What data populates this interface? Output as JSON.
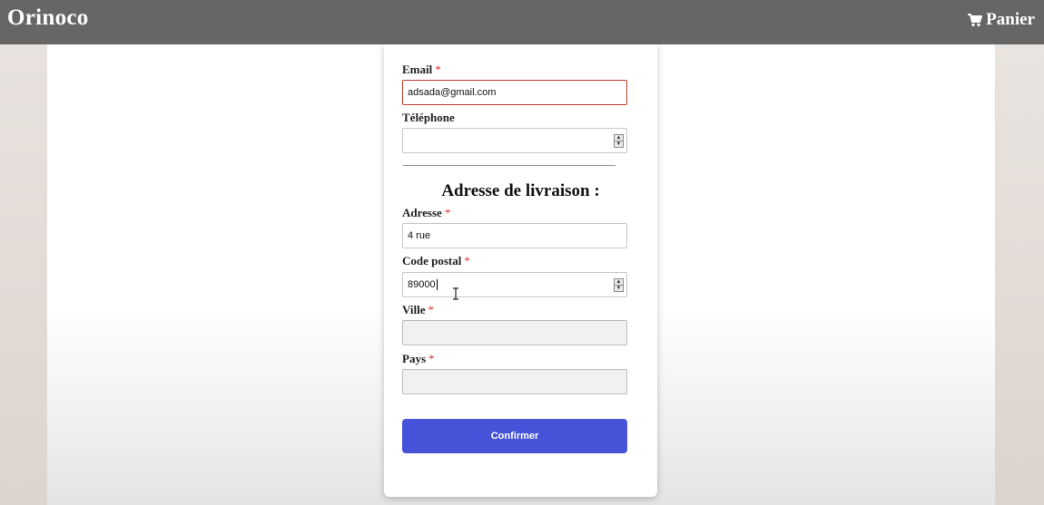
{
  "header": {
    "brand": "Orinoco",
    "cart_label": "Panier",
    "cart_icon": "shopping-cart-icon"
  },
  "form": {
    "email": {
      "label": "Email",
      "required_mark": "*",
      "value": "adsada@gmail.com"
    },
    "phone": {
      "label": "Téléphone",
      "value": ""
    },
    "section_title": "Adresse de livraison :",
    "address": {
      "label": "Adresse",
      "required_mark": "*",
      "value": "4 rue"
    },
    "postal_code": {
      "label": "Code postal",
      "required_mark": "*",
      "value": "89000"
    },
    "city": {
      "label": "Ville",
      "required_mark": "*",
      "value": ""
    },
    "country": {
      "label": "Pays",
      "required_mark": "*",
      "value": ""
    },
    "submit_label": "Confirmer"
  },
  "colors": {
    "header_bg": "#666666",
    "button_bg": "#4653d9",
    "error_border": "#c0392b",
    "required": "#dd3333"
  }
}
